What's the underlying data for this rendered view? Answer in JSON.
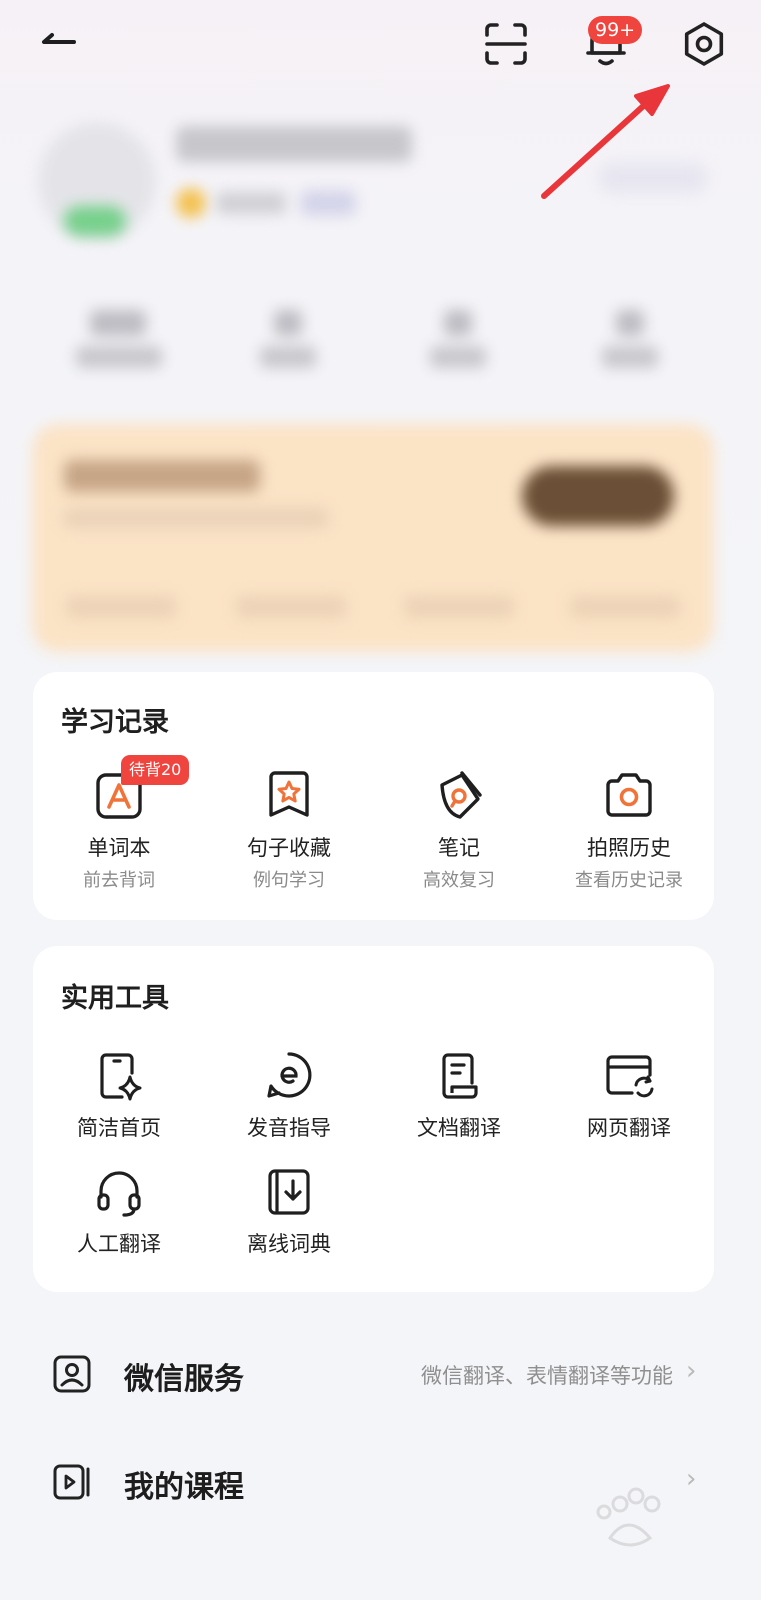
{
  "header": {
    "notification_badge": "99+",
    "icons": [
      "back-icon",
      "scan-icon",
      "bell-icon",
      "settings-icon"
    ]
  },
  "study_records": {
    "title": "学习记录",
    "pending_badge": "待背20",
    "items": [
      {
        "label": "单词本",
        "sub": "前去背词",
        "icon": "wordbook-icon"
      },
      {
        "label": "句子收藏",
        "sub": "例句学习",
        "icon": "sentence-bookmark-icon"
      },
      {
        "label": "笔记",
        "sub": "高效复习",
        "icon": "note-icon"
      },
      {
        "label": "拍照历史",
        "sub": "查看历史记录",
        "icon": "camera-icon"
      }
    ]
  },
  "tools": {
    "title": "实用工具",
    "items": [
      {
        "label": "简洁首页",
        "icon": "phone-sparkle-icon"
      },
      {
        "label": "发音指导",
        "icon": "pronunciation-icon"
      },
      {
        "label": "文档翻译",
        "icon": "document-icon"
      },
      {
        "label": "网页翻译",
        "icon": "webpage-icon"
      },
      {
        "label": "人工翻译",
        "icon": "headset-icon"
      },
      {
        "label": "离线词典",
        "icon": "download-dictionary-icon"
      }
    ]
  },
  "menu": [
    {
      "title": "微信服务",
      "desc": "微信翻译、表情翻译等功能",
      "icon": "wechat-service-icon"
    },
    {
      "title": "我的课程",
      "desc": "",
      "icon": "course-icon"
    }
  ],
  "colors": {
    "accent": "#f0443f",
    "icon_orange": "#f0743a",
    "annotation_arrow": "#e8363a"
  }
}
